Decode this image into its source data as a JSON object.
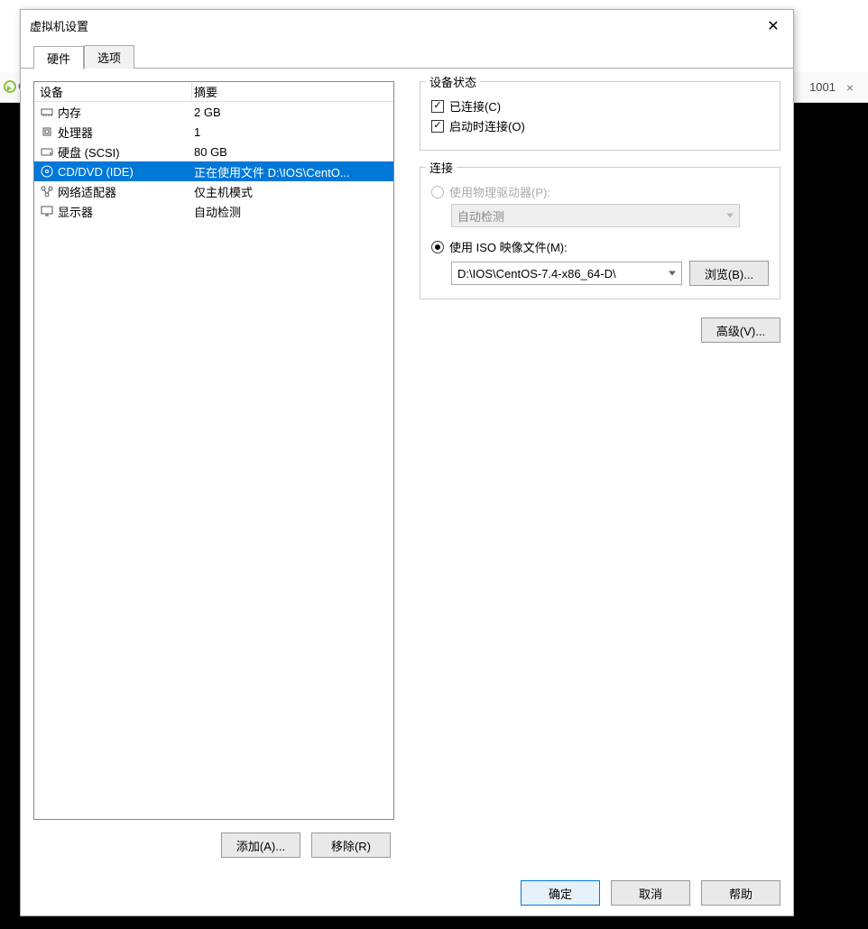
{
  "background": {
    "tab_label_fragment": "1001",
    "left_fragment": "C"
  },
  "dialog": {
    "title": "虚拟机设置",
    "tabs": {
      "hardware": "硬件",
      "options": "选项"
    },
    "device_list": {
      "header_device": "设备",
      "header_summary": "摘要",
      "rows": [
        {
          "icon": "memory",
          "name": "内存",
          "summary": "2 GB"
        },
        {
          "icon": "cpu",
          "name": "处理器",
          "summary": "1"
        },
        {
          "icon": "disk",
          "name": "硬盘 (SCSI)",
          "summary": "80 GB"
        },
        {
          "icon": "cd",
          "name": "CD/DVD (IDE)",
          "summary": "正在使用文件 D:\\IOS\\CentO..."
        },
        {
          "icon": "net",
          "name": "网络适配器",
          "summary": "仅主机模式"
        },
        {
          "icon": "display",
          "name": "显示器",
          "summary": "自动检测"
        }
      ],
      "selected_index": 3
    },
    "left_buttons": {
      "add": "添加(A)...",
      "remove": "移除(R)"
    },
    "right": {
      "status": {
        "title": "设备状态",
        "connected": {
          "label": "已连接(C)",
          "checked": true
        },
        "connect_at_poweron": {
          "label": "启动时连接(O)",
          "checked": true
        }
      },
      "connection": {
        "title": "连接",
        "physical": {
          "label": "使用物理驱动器(P):",
          "selected": false,
          "enabled": false,
          "value": "自动检测"
        },
        "iso": {
          "label": "使用 ISO 映像文件(M):",
          "selected": true,
          "value": "D:\\IOS\\CentOS-7.4-x86_64-D\\",
          "browse": "浏览(B)..."
        }
      },
      "advanced": "高级(V)..."
    },
    "footer": {
      "ok": "确定",
      "cancel": "取消",
      "help": "帮助"
    }
  }
}
